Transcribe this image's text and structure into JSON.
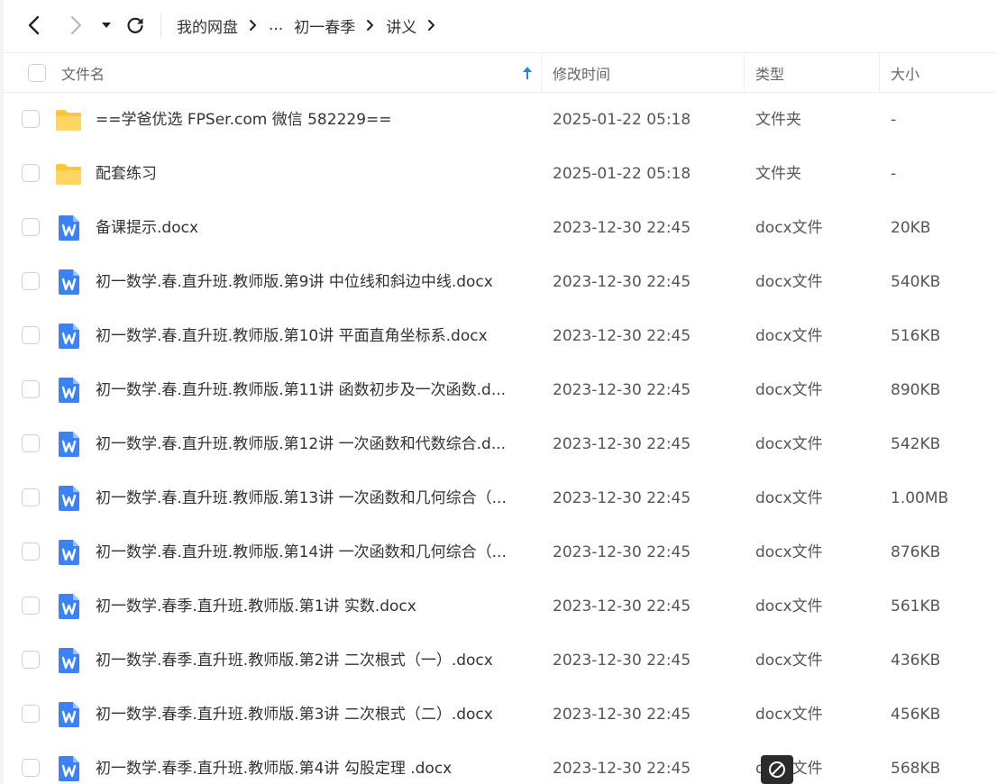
{
  "toolbar": {
    "back_icon": "chevron-left-icon",
    "forward_icon": "chevron-right-icon",
    "history_icon": "caret-down-icon",
    "refresh_icon": "refresh-icon"
  },
  "breadcrumb": {
    "items": [
      "我的网盘",
      "...",
      "初一春季",
      "讲义"
    ]
  },
  "table": {
    "columns": {
      "name": "文件名",
      "mtime": "修改时间",
      "type": "类型",
      "size": "大小"
    },
    "sort_icon": "arrow-up-icon",
    "rows": [
      {
        "icon": "folder-icon",
        "name": "==学爸优选 FPSer.com 微信 582229==",
        "mtime": "2025-01-22 05:18",
        "type": "文件夹",
        "size": "-"
      },
      {
        "icon": "folder-icon",
        "name": "配套练习",
        "mtime": "2025-01-22 05:18",
        "type": "文件夹",
        "size": "-"
      },
      {
        "icon": "word-doc-icon",
        "name": "备课提示.docx",
        "mtime": "2023-12-30 22:45",
        "type": "docx文件",
        "size": "20KB"
      },
      {
        "icon": "word-doc-icon",
        "name": "初一数学.春.直升班.教师版.第9讲  中位线和斜边中线.docx",
        "mtime": "2023-12-30 22:45",
        "type": "docx文件",
        "size": "540KB"
      },
      {
        "icon": "word-doc-icon",
        "name": "初一数学.春.直升班.教师版.第10讲  平面直角坐标系.docx",
        "mtime": "2023-12-30 22:45",
        "type": "docx文件",
        "size": "516KB"
      },
      {
        "icon": "word-doc-icon",
        "name": "初一数学.春.直升班.教师版.第11讲  函数初步及一次函数.d...",
        "mtime": "2023-12-30 22:45",
        "type": "docx文件",
        "size": "890KB"
      },
      {
        "icon": "word-doc-icon",
        "name": "初一数学.春.直升班.教师版.第12讲  一次函数和代数综合.d...",
        "mtime": "2023-12-30 22:45",
        "type": "docx文件",
        "size": "542KB"
      },
      {
        "icon": "word-doc-icon",
        "name": "初一数学.春.直升班.教师版.第13讲  一次函数和几何综合（...",
        "mtime": "2023-12-30 22:45",
        "type": "docx文件",
        "size": "1.00MB"
      },
      {
        "icon": "word-doc-icon",
        "name": "初一数学.春.直升班.教师版.第14讲  一次函数和几何综合（...",
        "mtime": "2023-12-30 22:45",
        "type": "docx文件",
        "size": "876KB"
      },
      {
        "icon": "word-doc-icon",
        "name": "初一数学.春季.直升班.教师版.第1讲  实数.docx",
        "mtime": "2023-12-30 22:45",
        "type": "docx文件",
        "size": "561KB"
      },
      {
        "icon": "word-doc-icon",
        "name": "初一数学.春季.直升班.教师版.第2讲  二次根式（一）.docx",
        "mtime": "2023-12-30 22:45",
        "type": "docx文件",
        "size": "436KB"
      },
      {
        "icon": "word-doc-icon",
        "name": "初一数学.春季.直升班.教师版.第3讲  二次根式（二）.docx",
        "mtime": "2023-12-30 22:45",
        "type": "docx文件",
        "size": "456KB"
      },
      {
        "icon": "word-doc-icon",
        "name": "初一数学.春季.直升班.教师版.第4讲  勾股定理    .docx",
        "mtime": "2023-12-30 22:45",
        "type": "docx文件",
        "size": "568KB"
      }
    ]
  },
  "overlay": {
    "icon": "no-entry-icon"
  },
  "colors": {
    "folder": "#FFC53D",
    "word": "#3B82F6",
    "sort_arrow": "#1E88E5"
  }
}
